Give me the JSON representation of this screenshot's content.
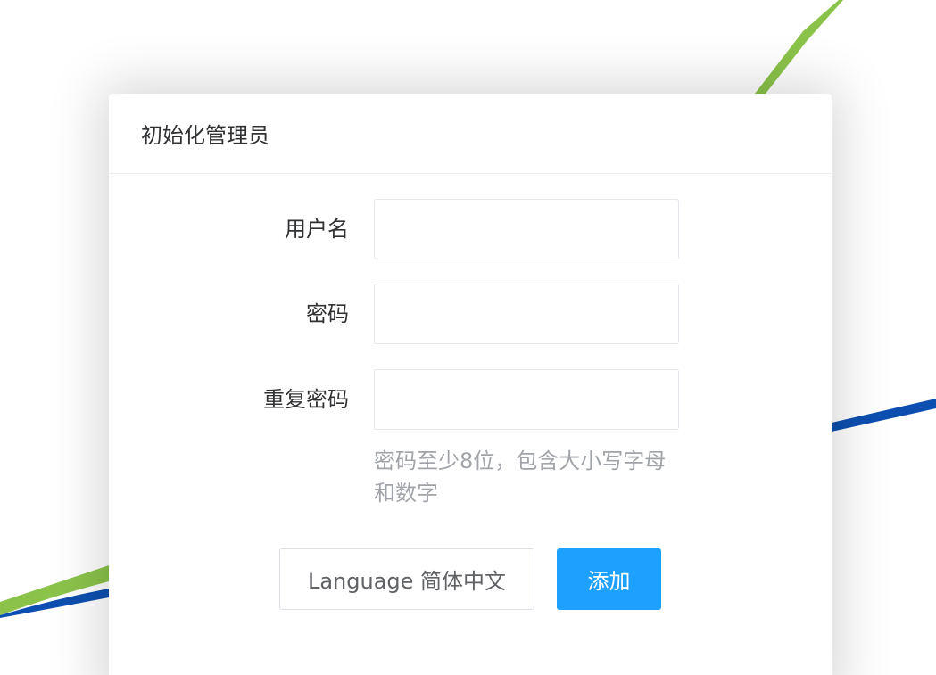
{
  "dialog": {
    "title": "初始化管理员"
  },
  "form": {
    "username": {
      "label": "用户名",
      "value": "",
      "placeholder": ""
    },
    "password": {
      "label": "密码",
      "value": "",
      "placeholder": ""
    },
    "confirm_password": {
      "label": "重复密码",
      "value": "",
      "placeholder": ""
    },
    "password_hint": "密码至少8位，包含大小写字母和数字"
  },
  "buttons": {
    "language_label": "Language 简体中文",
    "add_label": "添加"
  },
  "colors": {
    "primary": "#1ea0ff",
    "decor_green": "#8bc34a",
    "decor_blue": "#0d4fb0"
  }
}
